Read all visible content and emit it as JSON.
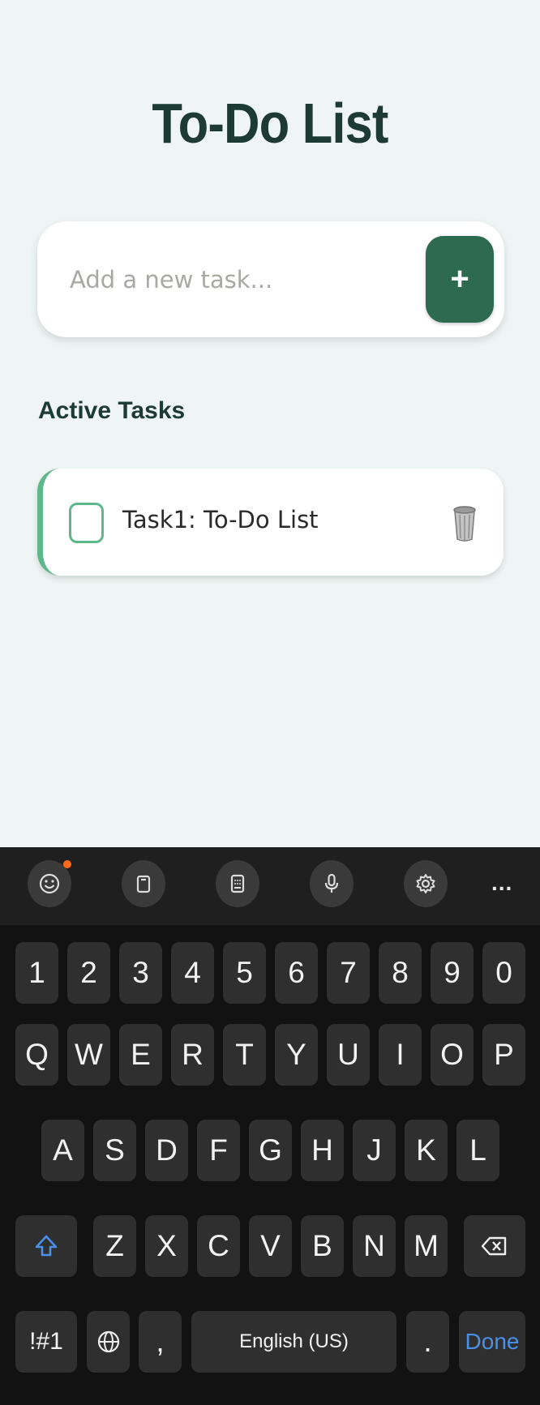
{
  "app": {
    "title": "To-Do List",
    "input": {
      "placeholder": "Add a new task...",
      "value": ""
    },
    "add_button_label": "+",
    "section_title": "Active Tasks",
    "tasks": [
      {
        "text": "Task1: To-Do List",
        "completed": false
      }
    ],
    "colors": {
      "accent": "#2d6a4f",
      "task_border": "#5fb88a",
      "background": "#eef5f4",
      "title": "#1d3b33"
    }
  },
  "keyboard": {
    "toolbar": [
      "emoji-icon",
      "clipboard-icon",
      "keypad-icon",
      "mic-icon",
      "gear-icon"
    ],
    "more_label": "...",
    "rows": [
      [
        "1",
        "2",
        "3",
        "4",
        "5",
        "6",
        "7",
        "8",
        "9",
        "0"
      ],
      [
        "Q",
        "W",
        "E",
        "R",
        "T",
        "Y",
        "U",
        "I",
        "O",
        "P"
      ],
      [
        "A",
        "S",
        "D",
        "F",
        "G",
        "H",
        "J",
        "K",
        "L"
      ],
      [
        "Z",
        "X",
        "C",
        "V",
        "B",
        "N",
        "M"
      ]
    ],
    "symbols_label": "!#1",
    "comma_label": ",",
    "space_label": "English (US)",
    "period_label": ".",
    "done_label": "Done"
  }
}
